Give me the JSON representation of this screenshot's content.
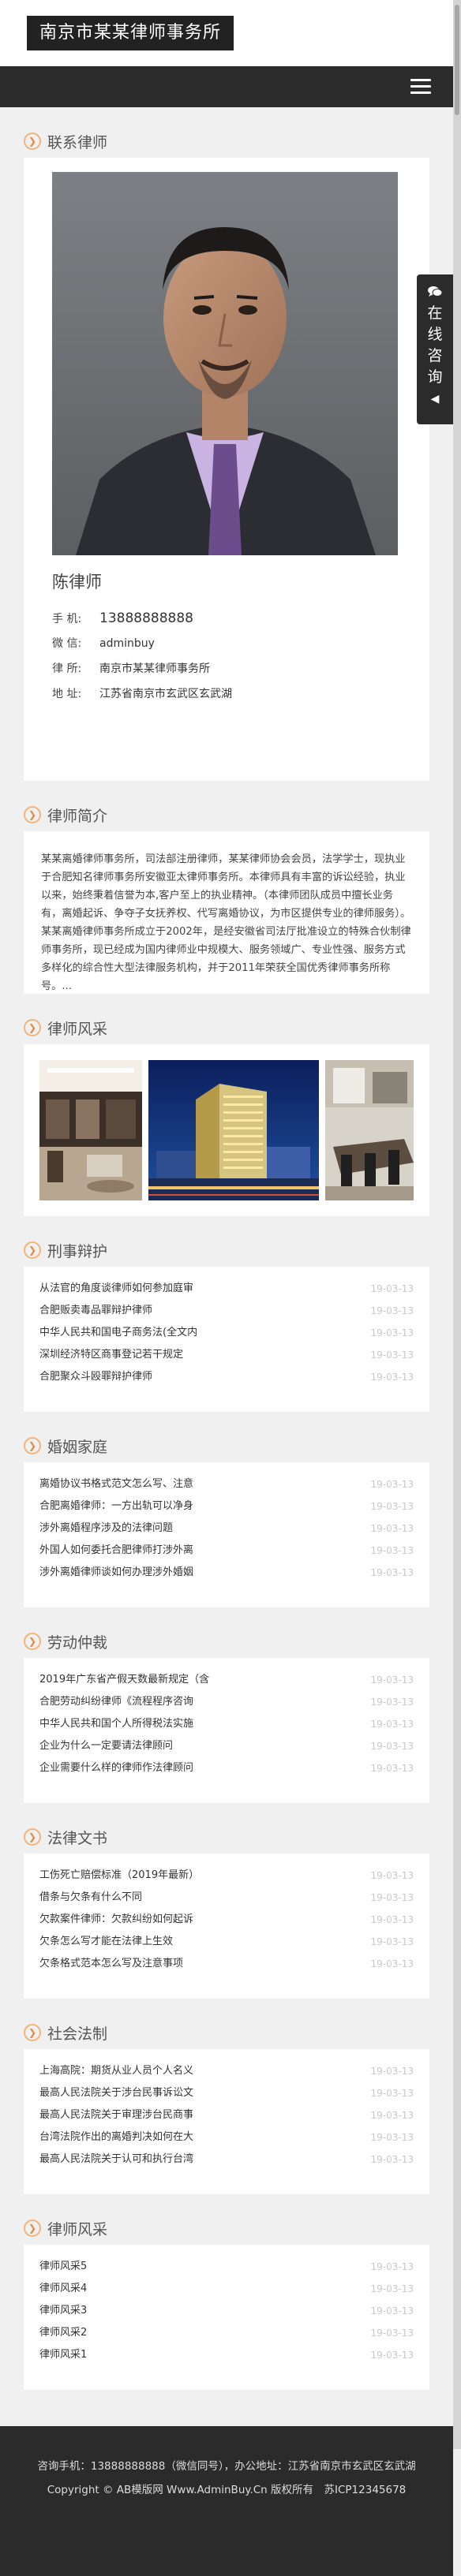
{
  "site": {
    "logo_text": "南京市某某律师事务所"
  },
  "float_consult": {
    "label": "在线咨询",
    "arrow": "◀"
  },
  "sections": {
    "contact": {
      "title": "联系律师",
      "name": "陈律师",
      "phone_label": "手 机:",
      "phone": "13888888888",
      "wechat_label": "微 信:",
      "wechat": "adminbuy",
      "firm_label": "律 所:",
      "firm": "南京市某某律师事务所",
      "address_label": "地 址:",
      "address": "江苏省南京市玄武区玄武湖"
    },
    "intro": {
      "title": "律师简介",
      "text": "某某离婚律师事务所，司法部注册律师，某某律师协会会员，法学学士，现执业于合肥知名律师事务所安徽亚太律师事务所。本律师具有丰富的诉讼经验，执业以来，始终秉着信誉为本,客户至上的执业精神。（本律师团队成员中擅长业务有，离婚起诉、争夺子女抚养权、代写离婚协议，为市区提供专业的律师服务）。某某离婚律师事务所成立于2002年，是经安徽省司法厅批准设立的特殊合伙制律师事务所，现已经成为国内律师业中规模大、服务领域广、专业性强、服务方式多样化的综合性大型法律服务机构，并于2011年荣获全国优秀律师事务所称号。..."
    },
    "gallery": {
      "title": "律师风采"
    },
    "criminal": {
      "title": "刑事辩护",
      "items": [
        {
          "t": "从法官的角度谈律师如何参加庭审",
          "d": "19-03-13"
        },
        {
          "t": "合肥贩卖毒品罪辩护律师",
          "d": "19-03-13"
        },
        {
          "t": "中华人民共和国电子商务法(全文内",
          "d": "19-03-13"
        },
        {
          "t": "深圳经济特区商事登记若干规定",
          "d": "19-03-13"
        },
        {
          "t": "合肥聚众斗殴罪辩护律师",
          "d": "19-03-13"
        }
      ]
    },
    "marriage": {
      "title": "婚姻家庭",
      "items": [
        {
          "t": "离婚协议书格式范文怎么写、注意",
          "d": "19-03-13"
        },
        {
          "t": "合肥离婚律师：一方出轨可以净身",
          "d": "19-03-13"
        },
        {
          "t": "涉外离婚程序涉及的法律问题",
          "d": "19-03-13"
        },
        {
          "t": "外国人如何委托合肥律师打涉外离",
          "d": "19-03-13"
        },
        {
          "t": "涉外离婚律师谈如何办理涉外婚姻",
          "d": "19-03-13"
        }
      ]
    },
    "labor": {
      "title": "劳动仲裁",
      "items": [
        {
          "t": "2019年广东省产假天数最新规定（含",
          "d": "19-03-13"
        },
        {
          "t": "合肥劳动纠纷律师《流程程序咨询",
          "d": "19-03-13"
        },
        {
          "t": "中华人民共和国个人所得税法实施",
          "d": "19-03-13"
        },
        {
          "t": "企业为什么一定要请法律顾问",
          "d": "19-03-13"
        },
        {
          "t": "企业需要什么样的律师作法律顾问",
          "d": "19-03-13"
        }
      ]
    },
    "legal_docs": {
      "title": "法律文书",
      "items": [
        {
          "t": "工伤死亡赔偿标准（2019年最新）",
          "d": "19-03-13"
        },
        {
          "t": "借条与欠条有什么不同",
          "d": "19-03-13"
        },
        {
          "t": "欠款案件律师：欠款纠纷如何起诉",
          "d": "19-03-13"
        },
        {
          "t": "欠条怎么写才能在法律上生效",
          "d": "19-03-13"
        },
        {
          "t": "欠条格式范本怎么写及注意事项",
          "d": "19-03-13"
        }
      ]
    },
    "social_law": {
      "title": "社会法制",
      "items": [
        {
          "t": "上海高院：期货从业人员个人名义",
          "d": "19-03-13"
        },
        {
          "t": "最高人民法院关于涉台民事诉讼文",
          "d": "19-03-13"
        },
        {
          "t": "最高人民法院关于审理涉台民商事",
          "d": "19-03-13"
        },
        {
          "t": "台湾法院作出的离婚判决如何在大",
          "d": "19-03-13"
        },
        {
          "t": "最高人民法院关于认可和执行台湾",
          "d": "19-03-13"
        }
      ]
    },
    "style": {
      "title": "律师风采",
      "items": [
        {
          "t": "律师风采5",
          "d": "19-03-13"
        },
        {
          "t": "律师风采4",
          "d": "19-03-13"
        },
        {
          "t": "律师风采3",
          "d": "19-03-13"
        },
        {
          "t": "律师风采2",
          "d": "19-03-13"
        },
        {
          "t": "律师风采1",
          "d": "19-03-13"
        }
      ]
    }
  },
  "footer": {
    "line1": "咨询手机：13888888888（微信同号），办公地址：江苏省南京市玄武区玄武湖",
    "line2": "Copyright © AB模版网 Www.AdminBuy.Cn 版权所有　苏ICP12345678"
  },
  "colors": {
    "accent": "#e08b40",
    "nav_bg": "#2b2b2b",
    "date": "#c8c8c8"
  }
}
